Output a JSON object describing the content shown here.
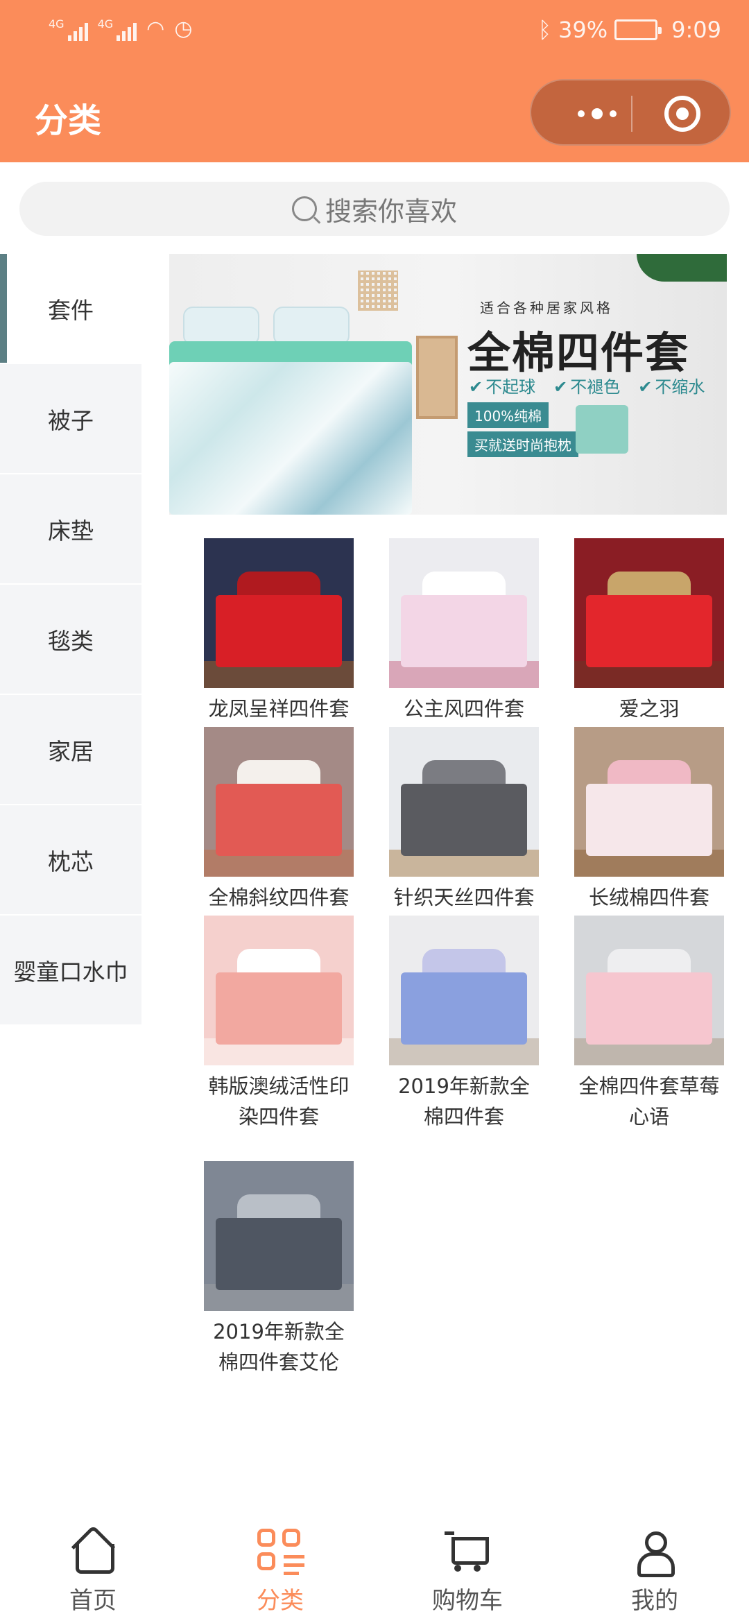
{
  "status_bar": {
    "network_left": "4G",
    "network_right": "4G",
    "battery": "39%",
    "time": "9:09"
  },
  "header": {
    "title": "分类"
  },
  "search": {
    "placeholder": "搜索你喜欢"
  },
  "sidebar": {
    "items": [
      {
        "label": "套件",
        "active": true
      },
      {
        "label": "被子",
        "active": false
      },
      {
        "label": "床垫",
        "active": false
      },
      {
        "label": "毯类",
        "active": false
      },
      {
        "label": "家居",
        "active": false
      },
      {
        "label": "枕芯",
        "active": false
      },
      {
        "label": "婴童口水巾",
        "active": false
      }
    ]
  },
  "banner": {
    "subtitle": "适合各种居家风格",
    "title": "全棉四件套",
    "features": [
      "不起球",
      "不褪色",
      "不缩水"
    ],
    "tag1": "100%纯棉",
    "tag2": "买就送时尚抱枕"
  },
  "products": [
    {
      "name": "龙凤呈祥四件套",
      "palette": {
        "wall": "#2c3350",
        "bed": "#d81f26",
        "head": "#b01a1f",
        "floor": "#6b4b3a"
      }
    },
    {
      "name": "公主风四件套",
      "palette": {
        "wall": "#ececf0",
        "bed": "#f3d6e6",
        "head": "#ffffff",
        "floor": "#d9a6b8"
      }
    },
    {
      "name": "爱之羽",
      "palette": {
        "wall": "#8a1d24",
        "bed": "#e3262c",
        "head": "#c8a56a",
        "floor": "#7a2a25"
      }
    },
    {
      "name": "全棉斜纹四件套",
      "palette": {
        "wall": "#a48a86",
        "bed": "#e25a54",
        "head": "#f4f0ec",
        "floor": "#b27c67"
      }
    },
    {
      "name": "针织天丝四件套",
      "palette": {
        "wall": "#e9ebee",
        "bed": "#5a5b60",
        "head": "#7b7c82",
        "floor": "#c9b59c"
      }
    },
    {
      "name": "长绒棉四件套",
      "palette": {
        "wall": "#b79c86",
        "bed": "#f6e7ea",
        "head": "#f0b9c5",
        "floor": "#a07c5c"
      }
    },
    {
      "name": "韩版澳绒活性印染四件套",
      "palette": {
        "wall": "#f5d0cd",
        "bed": "#f2a8a0",
        "head": "#ffffff",
        "floor": "#f9e5e2"
      }
    },
    {
      "name": "2019年新款全棉四件套",
      "palette": {
        "wall": "#ececee",
        "bed": "#8aa0df",
        "head": "#c4c6e9",
        "floor": "#cfc6bd"
      }
    },
    {
      "name": "全棉四件套草莓心语",
      "palette": {
        "wall": "#d5d7da",
        "bed": "#f6c6cf",
        "head": "#eeeef0",
        "floor": "#bfb6ad"
      }
    },
    {
      "name": "2019年新款全棉四件套艾伦",
      "palette": {
        "wall": "#7f8794",
        "bed": "#4f5662",
        "head": "#b9bfc7",
        "floor": "#8e939b"
      }
    }
  ],
  "tabbar": {
    "items": [
      {
        "label": "首页",
        "icon": "home-icon",
        "active": false
      },
      {
        "label": "分类",
        "icon": "category-icon",
        "active": true
      },
      {
        "label": "购物车",
        "icon": "cart-icon",
        "active": false
      },
      {
        "label": "我的",
        "icon": "user-icon",
        "active": false
      }
    ],
    "active_color": "#fb8c5a"
  },
  "colors": {
    "brand": "#fb8c5a",
    "sidebar_active_indicator": "#5c7f84"
  }
}
